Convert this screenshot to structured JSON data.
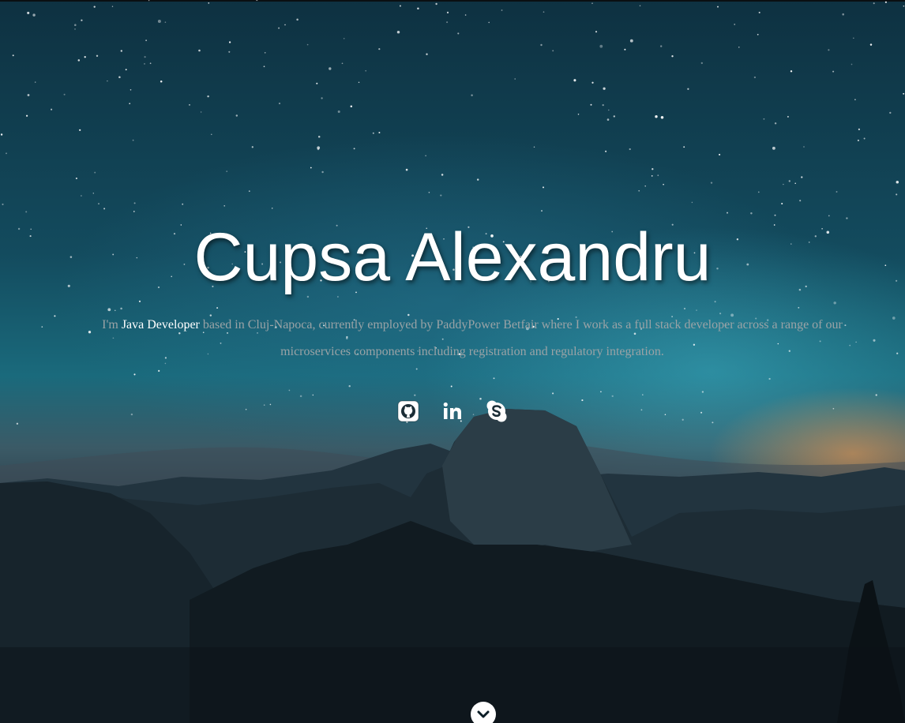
{
  "hero": {
    "name": "Cupsa Alexandru",
    "bio": {
      "prefix": "I'm ",
      "highlight": "Java Developer",
      "line1_rest": " based in Cluj-Napoca, currently employed by PaddyPower Betfair where I work as a full stack developer across a range of our",
      "line2": "microservices components including registration and regulatory integration."
    },
    "socials": [
      {
        "network": "github",
        "icon": "github-icon"
      },
      {
        "network": "linkedin",
        "icon": "linkedin-icon"
      },
      {
        "network": "skype",
        "icon": "skype-icon"
      }
    ],
    "scroll_icon": "chevron-down-icon"
  },
  "colors": {
    "text_primary": "#ffffff",
    "text_muted": "#9aa3a6",
    "sky_top": "#0e3141",
    "sky_mid": "#1a6a7c",
    "horizon_glow": "#e69650"
  }
}
